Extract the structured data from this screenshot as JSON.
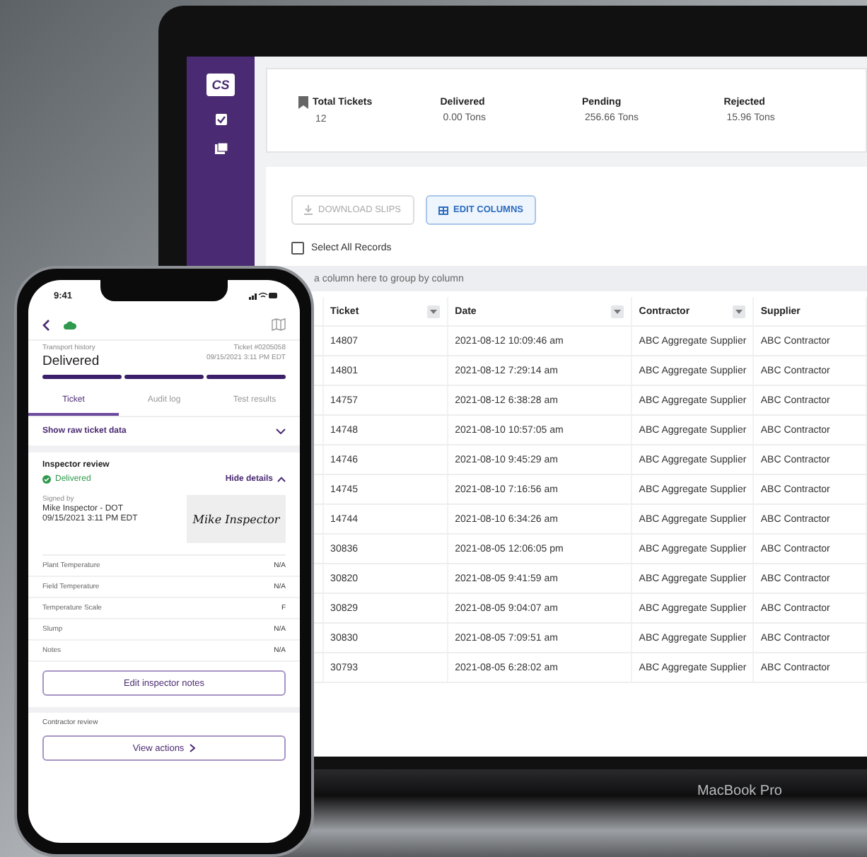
{
  "laptop": {
    "brand": "MacBook Pro",
    "sidebar": {
      "logo": "CS"
    },
    "summary": [
      {
        "label": "Total Tickets",
        "value": "12"
      },
      {
        "label": "Delivered",
        "value": "0.00 Tons"
      },
      {
        "label": "Pending",
        "value": "256.66 Tons"
      },
      {
        "label": "Rejected",
        "value": "15.96 Tons"
      }
    ],
    "buttons": [
      {
        "label": "DOWNLOAD SLIPS",
        "disabled": true
      },
      {
        "label": "EDIT COLUMNS",
        "disabled": false
      }
    ],
    "select_all": {
      "label": "Select All Records",
      "checked": false
    },
    "group_hint": "a column here to group by column",
    "table": {
      "columns": [
        "Ticket",
        "Date",
        "Contractor",
        "Supplier"
      ],
      "rows": [
        [
          "14807",
          "2021-08-12 10:09:46 am",
          "ABC Aggregate Supplier",
          "ABC Contractor"
        ],
        [
          "14801",
          "2021-08-12 7:29:14 am",
          "ABC Aggregate Supplier",
          "ABC Contractor"
        ],
        [
          "14757",
          "2021-08-12 6:38:28 am",
          "ABC Aggregate Supplier",
          "ABC Contractor"
        ],
        [
          "14748",
          "2021-08-10 10:57:05 am",
          "ABC Aggregate Supplier",
          "ABC Contractor"
        ],
        [
          "14746",
          "2021-08-10 9:45:29 am",
          "ABC Aggregate Supplier",
          "ABC Contractor"
        ],
        [
          "14745",
          "2021-08-10 7:16:56 am",
          "ABC Aggregate Supplier",
          "ABC Contractor"
        ],
        [
          "14744",
          "2021-08-10 6:34:26 am",
          "ABC Aggregate Supplier",
          "ABC Contractor"
        ],
        [
          "30836",
          "2021-08-05 12:06:05 pm",
          "ABC Aggregate Supplier",
          "ABC Contractor"
        ],
        [
          "30820",
          "2021-08-05 9:41:59 am",
          "ABC Aggregate Supplier",
          "ABC Contractor"
        ],
        [
          "30829",
          "2021-08-05 9:04:07 am",
          "ABC Aggregate Supplier",
          "ABC Contractor"
        ],
        [
          "30830",
          "2021-08-05 7:09:51 am",
          "ABC Aggregate Supplier",
          "ABC Contractor"
        ],
        [
          "30793",
          "2021-08-05 6:28:02 am",
          "ABC Aggregate Supplier",
          "ABC Contractor"
        ]
      ]
    }
  },
  "phone": {
    "status_time": "9:41",
    "header": {
      "subtitle": "Transport history",
      "title": "Delivered",
      "ticket": "Ticket #0205058",
      "timestamp": "09/15/2021 3:11 PM EDT"
    },
    "progress": [
      {
        "done": true
      },
      {
        "done": true
      },
      {
        "done": true
      }
    ],
    "tabs": [
      {
        "label": "Ticket",
        "selected": true
      },
      {
        "label": "Audit log",
        "selected": false
      },
      {
        "label": "Test results",
        "selected": false
      }
    ],
    "raw_link": "Show raw ticket data",
    "inspector": {
      "title": "Inspector review",
      "status": "Delivered",
      "toggle": "Hide details",
      "expanded": true,
      "signed_label": "Signed by",
      "signer": "Mike Inspector - DOT",
      "signed_at": "09/15/2021 3:11 PM EDT",
      "signature": "Mike Inspector"
    },
    "fields": [
      {
        "label": "Plant Temperature",
        "value": "N/A"
      },
      {
        "label": "Field Temperature",
        "value": "N/A"
      },
      {
        "label": "Temperature Scale",
        "value": "F"
      },
      {
        "label": "Slump",
        "value": "N/A"
      },
      {
        "label": "Notes",
        "value": "N/A"
      }
    ],
    "edit_button": "Edit inspector notes",
    "contractor_title": "Contractor review",
    "actions_button": "View actions"
  }
}
